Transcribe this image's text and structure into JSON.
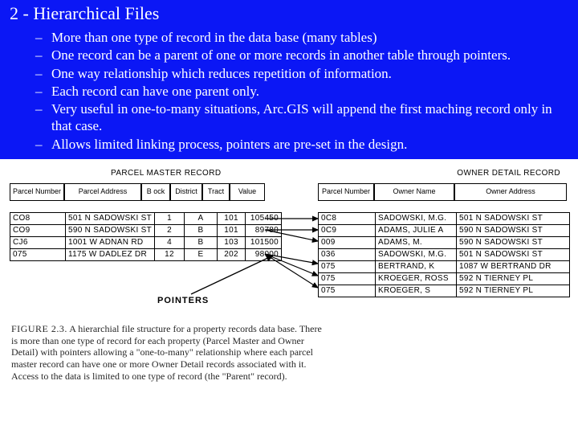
{
  "title": "2 - Hierarchical Files",
  "bullets": [
    "  More than one type of record in the data base (many tables)",
    "One record can be a parent of one or more records in another table through pointers.",
    "One way relationship which reduces repetition of information.",
    "Each record can have one parent only.",
    "Very useful in one-to-many situations, Arc.GIS will append the first maching record only in that case.",
    "Allows limited linking process, pointers are pre-set in the design."
  ],
  "section_titles": {
    "parcel": "PARCEL MASTER RECORD",
    "owner": "OWNER DETAIL RECORD"
  },
  "headers": {
    "pn": "Parcel Number",
    "pa": "Parcel Address",
    "bl": "B ock",
    "di": "District",
    "tr": "Tract",
    "va": "Value",
    "opn": "Parcel Number",
    "on": "Owner Name",
    "oa": "Owner Address"
  },
  "parcel_rows": [
    {
      "pn": "CO8",
      "addr": "501 N SADOWSKI ST",
      "block": "1",
      "dist": "A",
      "tract": "101",
      "val": "105450"
    },
    {
      "pn": "CO9",
      "addr": "590 N SADOWSKI ST",
      "block": "2",
      "dist": "B",
      "tract": "101",
      "val": "89780"
    },
    {
      "pn": "CJ6",
      "addr": "1001 W ADNAN RD",
      "block": "4",
      "dist": "B",
      "tract": "103",
      "val": "101500"
    },
    {
      "pn": "075",
      "addr": "1175 W DADLEZ DR",
      "block": "12",
      "dist": "E",
      "tract": "202",
      "val": "98000"
    }
  ],
  "owner_rows": [
    {
      "pn": "0C8",
      "name": "SADOWSKI, M.G.",
      "addr": "501 N SADOWSKI ST"
    },
    {
      "pn": "0C9",
      "name": "ADAMS, JULIE A",
      "addr": "590 N SADOWSKI ST"
    },
    {
      "pn": "009",
      "name": "ADAMS, M.",
      "addr": "590 N SADOWSKI ST"
    },
    {
      "pn": "036",
      "name": "SADOWSKI, M.G.",
      "addr": "501 N SADOWSKI ST"
    },
    {
      "pn": "075",
      "name": "BERTRAND, K",
      "addr": "1087 W BERTRAND DR"
    },
    {
      "pn": "075",
      "name": "KROEGER, ROSS",
      "addr": "592 N TIERNEY PL"
    },
    {
      "pn": "075",
      "name": "KROEGER, S",
      "addr": "592 N TIERNEY PL"
    }
  ],
  "pointers_label": "POINTERS",
  "caption_lead": "FIGURE 2.3.",
  "caption_body": "A hierarchial file structure for a property records data base. There is more than one type of record for each property (Parcel Master and Owner Detail) with pointers allowing a \"one-to-many\" relationship where each parcel master record can have one or more Owner Detail records associated with it. Access to the data is limited to one type of record (the \"Parent\" record)."
}
